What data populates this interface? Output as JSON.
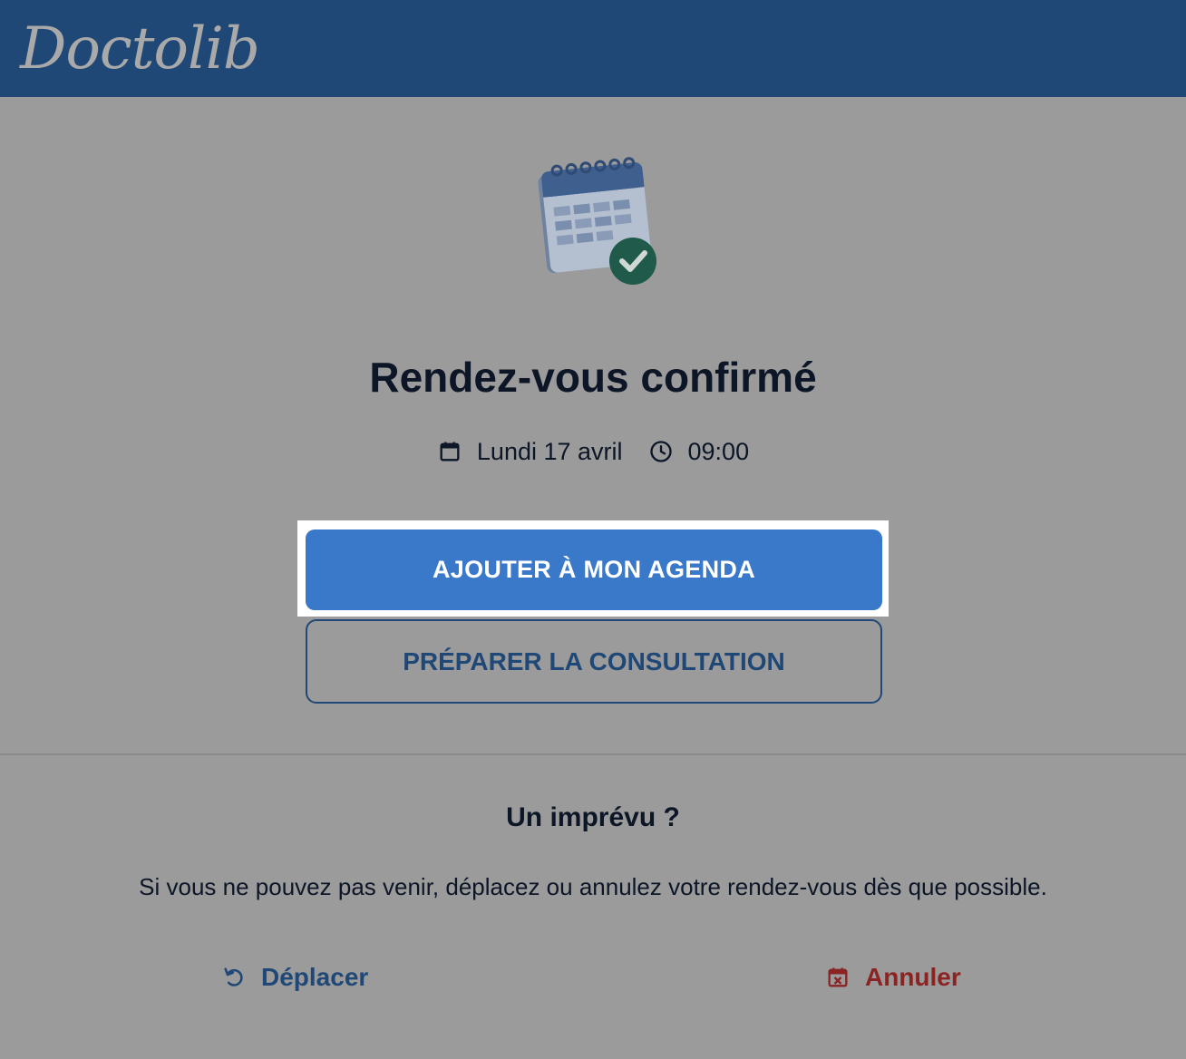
{
  "header": {
    "logo_text": "Doctolib",
    "color": "#204877"
  },
  "confirmation": {
    "illustration_icon": "calendar-check-icon",
    "title": "Rendez-vous confirmé",
    "date_icon": "calendar-icon",
    "date": "Lundi 17 avril",
    "time_icon": "clock-icon",
    "time": "09:00"
  },
  "actions": {
    "add_to_agenda_label": "AJOUTER À MON AGENDA",
    "prepare_label": "PRÉPARER LA CONSULTATION",
    "primary_color": "#3a78c9"
  },
  "unforeseen": {
    "title": "Un imprévu ?",
    "description": "Si vous ne pouvez pas venir, déplacez ou annulez votre rendez-vous dès que possible.",
    "move_icon": "undo-icon",
    "move_label": "Déplacer",
    "cancel_icon": "calendar-x-icon",
    "cancel_label": "Annuler",
    "cancel_color": "#8b2323"
  }
}
